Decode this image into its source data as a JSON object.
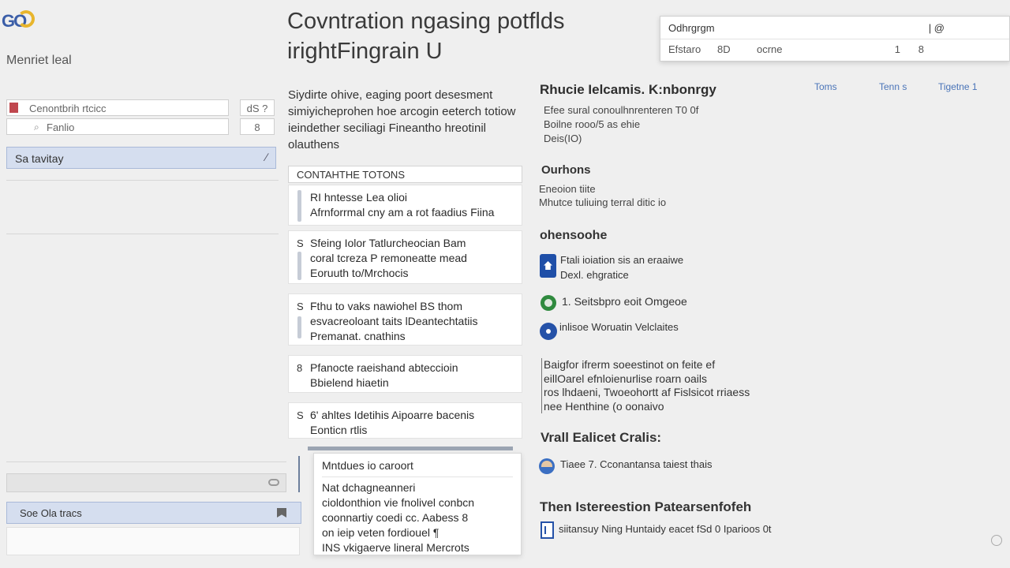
{
  "app": {
    "logo_text": "GO",
    "left_title": "Menriet leal"
  },
  "header": {
    "title_line1": "Covntration ngasing potflds",
    "title_line2": "irightFingrain U"
  },
  "filters": {
    "field1_text": "Cenontbrih rtcicc",
    "field1_button": "dS ?",
    "field2_text": "Fanlio",
    "field2_button": "8",
    "category_label": "Sa tavitay",
    "category_chevron": "∕"
  },
  "left_bottom": {
    "bar_label": "Soe Ola tracs"
  },
  "intro": {
    "text": "Siydirte ohive, eaging poort desesment simiyicheprohen hoe arcogin eeterch totiow ieindether seciliagi Fineantho hreotinil olauthens"
  },
  "list": {
    "header": "CONTAHTHE TOTONS",
    "cards": [
      {
        "num": "",
        "line1": "RI hntesse Lea olioi",
        "line2": "Afrnforrmal cny am a rot faadius Fiina",
        "line3": ""
      },
      {
        "num": "S",
        "line1": "Sfeing Iolor Tatlurcheocian Bam",
        "line2": "coral tcreza P remoneatte mead",
        "line3": "Eoruuth to/Mrchocis"
      },
      {
        "num": "S",
        "line1": "Fthu to vaks nawiohel BS thom",
        "line2": "esvacreoloant taits lDeantechtatiis",
        "line3": "Premanat. cnathins"
      },
      {
        "num": "8",
        "line1": "Pfanocte raeishand abteccioin",
        "line2": "Bbielend hiaetin",
        "line3": ""
      },
      {
        "num": "S",
        "line1": "6' ahltes Idetihis Aipoarre bacenis",
        "line2": "Eonticn rtlis",
        "line3": ""
      }
    ]
  },
  "popup": {
    "head": "Mntdues io caroort",
    "lines": [
      "Nat dchagneanneri",
      "cioldonthion vie fnolivel conbcn",
      "coonnartiy coedi cc. Aabess 8",
      "on ieip veten fordiouel ¶",
      "INS vkigaerve lineral Mercrots"
    ]
  },
  "right": {
    "section1_title": "Rhucie Ielcamis. K:nbonrgy",
    "section1_lines": [
      "Efee sural conoulhnrenteren T0 0f",
      "Boilne rooo/5 as ehie",
      "Deis(IO)"
    ],
    "section2_title": "Ourhons",
    "section2_lines": [
      "Eneoion tiite",
      "Mhutce tuliuing terral ditic io"
    ],
    "section3_title": "ohensoohe",
    "step1_lines": [
      "Ftali ioiation sis an eraaiwe",
      "Dexl. ehgratice"
    ],
    "step2": "1. Seitsbpro eoit Omgeoe",
    "step3": "inlisoe Woruatin Velclaites",
    "section4_lines": [
      "Baigfor ifrerm soeestinot on feite ef",
      "eillOarel efnloienurlise roarn oails",
      "ros lhdaeni, Twoeohortt af Fislsicot rriaess",
      "nee Henthine (o oonaivo"
    ],
    "section5_title": "Vrall Ealicet Cralis:",
    "step5": "Tiaee 7. Cconantansa taiest thais",
    "section6_title": "Then Istereestion Patearsenfofeh",
    "step6": "siitansuy Ning Huntaidy eacet fSd 0 Iparioos 0t"
  },
  "search_panel": {
    "row1_left": "Odhrgrgm",
    "row1_right": "| @",
    "row2_left": "Efstaro",
    "row2_mid": "8D",
    "row2_right": "ocrne",
    "row2_pipe": "1",
    "row2_icon": "8"
  },
  "tabs": [
    "Toms",
    "Tenn s",
    "Tigetne 1"
  ],
  "colors": {
    "accent": "#3b5ea8",
    "selection_bg": "#d5deef",
    "logo_ring": "#e8b52c",
    "red_swatch": "#c0474e",
    "green_icon": "#2f8a3e"
  }
}
